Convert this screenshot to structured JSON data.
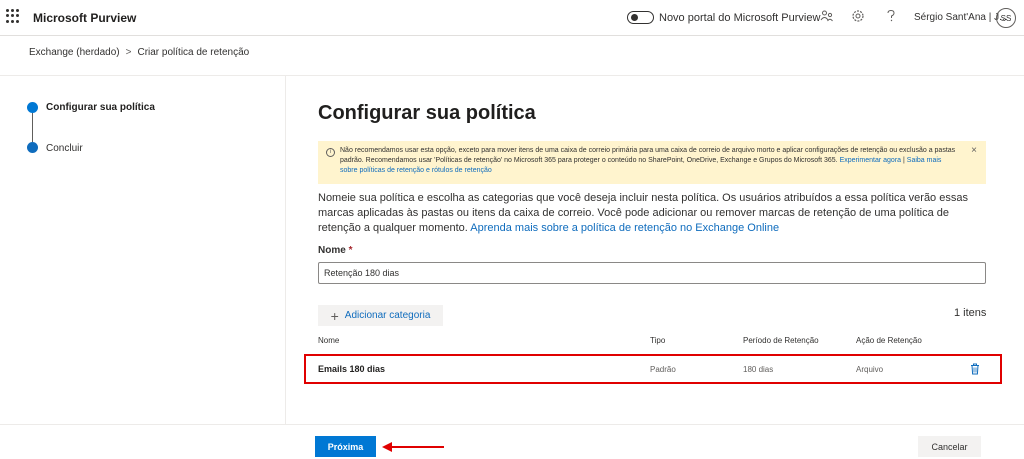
{
  "header": {
    "app_name": "Microsoft Purview",
    "toggle_label": "Novo portal do Microsoft Purview",
    "user_name": "Sérgio Sant'Ana | J...",
    "user_initials": "SS",
    "icons": [
      "waffle-icon",
      "people-icon",
      "gear-icon",
      "help-icon"
    ]
  },
  "breadcrumb": {
    "items": [
      "Exchange (herdado)",
      "Criar política de retenção"
    ],
    "separator": ">"
  },
  "steps": [
    {
      "label": "Configurar sua política",
      "active": true
    },
    {
      "label": "Concluir",
      "active": false
    }
  ],
  "main": {
    "title": "Configurar sua política",
    "warning": {
      "text": "Não recomendamos usar esta opção, exceto para mover itens de uma caixa de correio primária para uma caixa de correio de arquivo morto e aplicar configurações de retenção ou exclusão a pastas padrão. Recomendamos usar 'Políticas de retenção' no Microsoft 365 para proteger o conteúdo no SharePoint, OneDrive, Exchange e Grupos do Microsoft 365. ",
      "link1": "Experimentar agora",
      "link_sep": " | ",
      "link2": "Saiba mais sobre políticas de retenção e rótulos de retenção",
      "info_glyph": "i",
      "close_glyph": "×"
    },
    "description": "Nomeie sua política e escolha as categorias que você deseja incluir nesta política. Os usuários atribuídos a essa política verão essas marcas aplicadas às pastas ou itens da caixa de correio. Você pode adicionar ou remover marcas de retenção de uma política de retenção a qualquer momento. ",
    "description_link": "Aprenda mais sobre a política de retenção no Exchange Online",
    "name_label": "Nome",
    "required_mark": "*",
    "name_value": "Retenção 180 dias",
    "add_category_label": "Adicionar categoria",
    "items_count": "1 itens",
    "table": {
      "headers": [
        "Nome",
        "Tipo",
        "Período de Retenção",
        "Ação de Retenção"
      ],
      "rows": [
        {
          "nome": "Emails 180 dias",
          "tipo": "Padrão",
          "periodo": "180 dias",
          "acao": "Arquivo"
        }
      ]
    }
  },
  "footer": {
    "next_label": "Próxima",
    "cancel_label": "Cancelar"
  },
  "colors": {
    "accent": "#0078d4",
    "warning_bg": "#fff4ce",
    "highlight_border": "#e00000",
    "arrow": "#e00000"
  }
}
